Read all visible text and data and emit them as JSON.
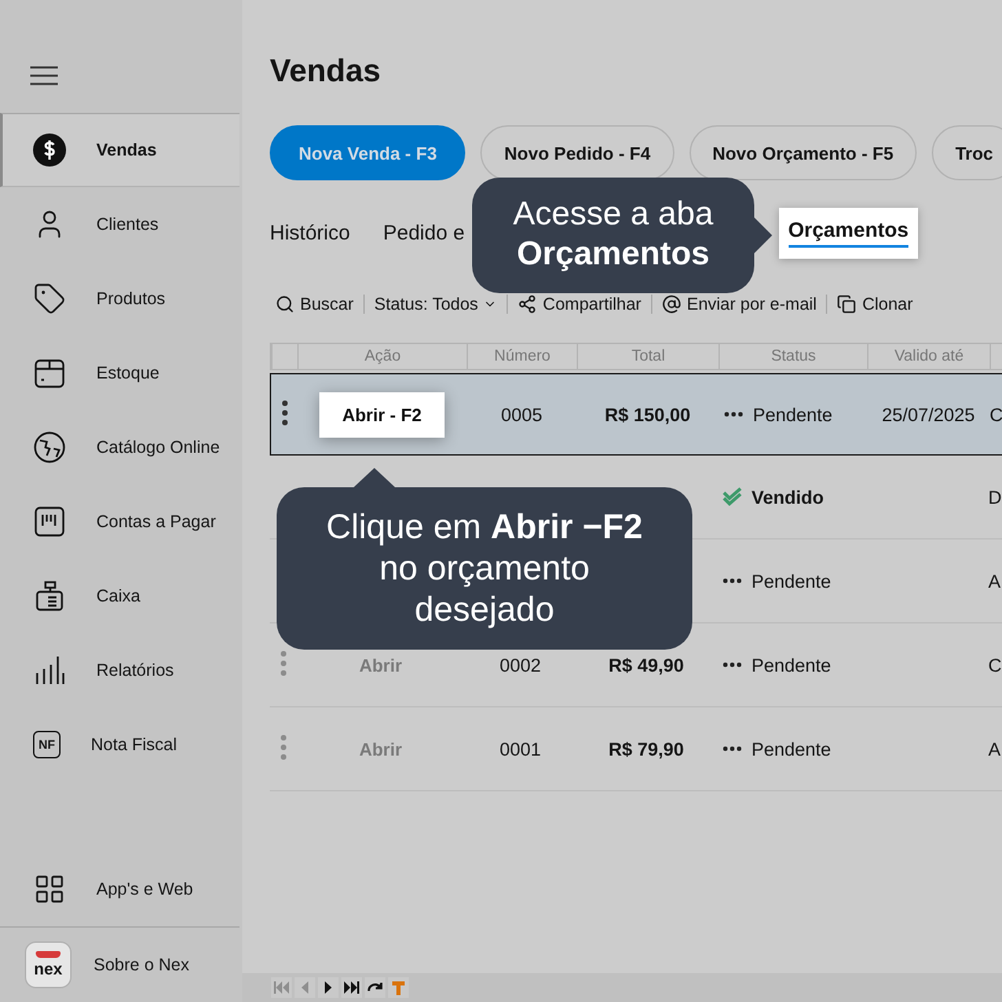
{
  "sidebar": {
    "items": [
      {
        "label": "Vendas",
        "selected": true
      },
      {
        "label": "Clientes",
        "selected": false
      },
      {
        "label": "Produtos",
        "selected": false
      },
      {
        "label": "Estoque",
        "selected": false
      },
      {
        "label": "Catálogo Online",
        "selected": false
      },
      {
        "label": "Contas a Pagar",
        "selected": false
      },
      {
        "label": "Caixa",
        "selected": false
      },
      {
        "label": "Relatórios",
        "selected": false
      },
      {
        "label": "Nota Fiscal",
        "selected": false,
        "badge": "NF"
      }
    ],
    "footer_items": [
      {
        "label": "App's e Web"
      },
      {
        "label": "Sobre o Nex",
        "logo_text": "nex"
      }
    ]
  },
  "page": {
    "title": "Vendas"
  },
  "actions": [
    {
      "label": "Nova Venda - F3",
      "kind": "primary"
    },
    {
      "label": "Novo Pedido - F4",
      "kind": "outline"
    },
    {
      "label": "Novo Orçamento - F5",
      "kind": "outline"
    },
    {
      "label": "Troc",
      "kind": "outline"
    }
  ],
  "tabs": [
    {
      "label": "Histórico",
      "selected": false
    },
    {
      "label": "Pedido e",
      "selected": false
    },
    {
      "label": "Orçamentos",
      "selected": true
    }
  ],
  "toolbar": [
    {
      "label": "Buscar",
      "kind": "search"
    },
    {
      "label": "Status: Todos",
      "kind": "dropdown"
    },
    {
      "label": "Compartilhar",
      "kind": "share"
    },
    {
      "label": "Enviar por e-mail",
      "kind": "email"
    },
    {
      "label": "Clonar",
      "kind": "clone"
    }
  ],
  "table": {
    "columns": [
      "Ação",
      "Número",
      "Total",
      "Status",
      "Valido até"
    ],
    "rows": [
      {
        "selected": true,
        "action": "Abrir - F2",
        "number": "0005",
        "total": "R$ 150,00",
        "status": {
          "label": "Pendente",
          "kind": "pending"
        },
        "valid_until": "25/07/2025",
        "column_7": "C"
      },
      {
        "selected": false,
        "status": {
          "label": "Vendido",
          "kind": "sold"
        },
        "column_7": "D"
      },
      {
        "selected": false,
        "status": {
          "label": "Pendente",
          "kind": "pending"
        },
        "column_7": "A"
      },
      {
        "selected": false,
        "action": "Abrir",
        "number": "0002",
        "total": "R$ 49,90",
        "status": {
          "label": "Pendente",
          "kind": "pending"
        },
        "column_7": "C"
      },
      {
        "selected": false,
        "action": "Abrir",
        "number": "0001",
        "total": "R$ 79,90",
        "status": {
          "label": "Pendente",
          "kind": "pending"
        },
        "column_7": "A"
      }
    ]
  },
  "pager": [
    {
      "disabled": true
    },
    {
      "disabled": true
    },
    {
      "disabled": false
    },
    {
      "disabled": false
    },
    {
      "disabled": false
    },
    {
      "disabled": false
    }
  ],
  "callouts": [
    {
      "text": "Acesse a aba **Orçamentos**"
    },
    {
      "text": "Clique em **Abrir −F2** no orçamento desejado"
    }
  ]
}
